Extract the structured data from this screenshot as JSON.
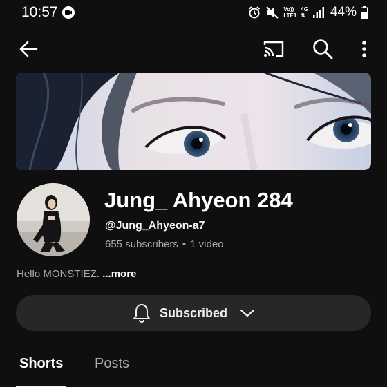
{
  "status_bar": {
    "time": "10:57",
    "battery_percent": "44%",
    "network_top": "Vo))",
    "network_mid": "LTE1",
    "network_gen": "4G"
  },
  "top_bar": {
    "icons": [
      "back-arrow-icon",
      "cast-icon",
      "search-icon",
      "more-vert-icon"
    ]
  },
  "channel": {
    "name": "Jung_ Ahyeon 284",
    "handle": "@Jung_Ahyeon-a7",
    "subscribers": "655 subscribers",
    "separator": "•",
    "videos": "1 video",
    "description": "Hello MONSTIEZ.",
    "more_label": "...more"
  },
  "subscribe_button": {
    "label": "Subscribed"
  },
  "tabs": [
    {
      "label": "Shorts",
      "active": true
    },
    {
      "label": "Posts",
      "active": false
    }
  ],
  "colors": {
    "background": "#0f0f0f",
    "button_bg": "#272727",
    "secondary_text": "#aaaaaa"
  }
}
